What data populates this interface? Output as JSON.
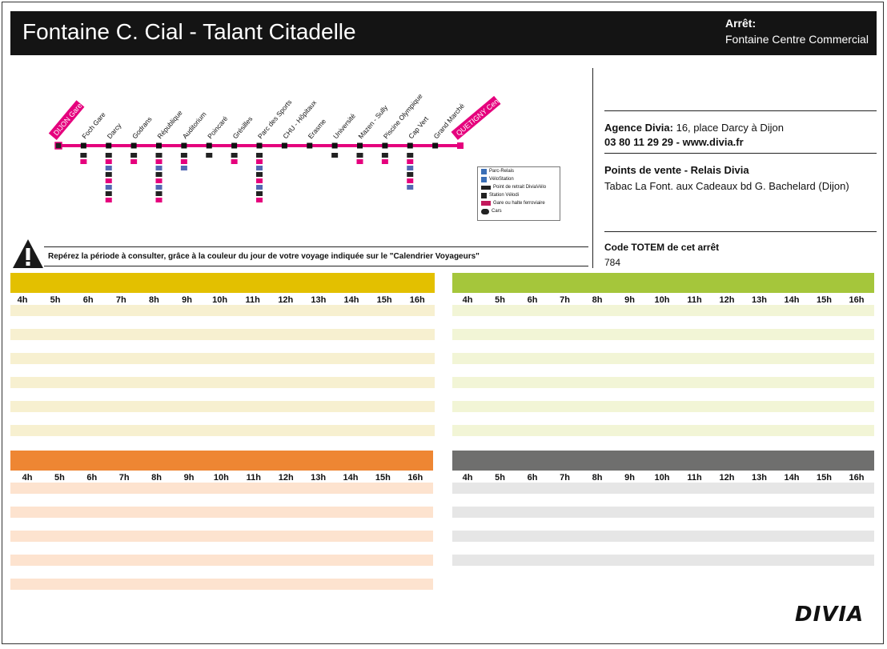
{
  "header": {
    "title": "Fontaine C. Cial - Talant Citadelle",
    "stop_label": "Arrêt:",
    "stop_name": "Fontaine Centre Commercial"
  },
  "info": {
    "agency_label": "Agence Divia:",
    "agency_address": " 16, place Darcy à Dijon",
    "agency_contact": "03 80 11 29 29 - www.divia.fr",
    "sales_title": "Points de vente - Relais Divia",
    "sales_text": "Tabac La Font. aux Cadeaux bd G. Bachelard (Dijon)",
    "totem_label": "Code TOTEM de cet arrêt",
    "totem_code": "784"
  },
  "warning": "Repérez la période à consulter, grâce à la couleur du jour de votre voyage indiquée sur le \"Calendrier Voyageurs\"",
  "route": {
    "line_color": "#e5007d",
    "start_terminal": "DIJON Gare",
    "end_terminal": "QUETIGNY Centre",
    "stops": [
      "Foch Gare",
      "Darcy",
      "Godrans",
      "République",
      "Auditorium",
      "Poincaré",
      "Grésilles",
      "Parc des Sports",
      "CHU - Hôpitaux",
      "Erasme",
      "Université",
      "Mazen - Sully",
      "Piscine Olympique",
      "Cap Vert",
      "Grand Marché"
    ]
  },
  "legend": {
    "items": [
      "Parc-Relais",
      "VéloStation",
      "Point de retrait DiviaVélo",
      "Station Vélodi",
      "Gare ou halte ferroviaire",
      "Cars"
    ]
  },
  "timetables": [
    {
      "color": "#e3c000",
      "row_color": "#f7f0d0",
      "hours": [
        "4h",
        "5h",
        "6h",
        "7h",
        "8h",
        "9h",
        "10h",
        "11h",
        "12h",
        "13h",
        "14h",
        "15h",
        "16h"
      ]
    },
    {
      "color": "#a5c63b",
      "row_color": "#f2f5d6",
      "hours": [
        "4h",
        "5h",
        "6h",
        "7h",
        "8h",
        "9h",
        "10h",
        "11h",
        "12h",
        "13h",
        "14h",
        "15h",
        "16h"
      ]
    },
    {
      "color": "#ee8633",
      "row_color": "#fde3cf",
      "hours": [
        "4h",
        "5h",
        "6h",
        "7h",
        "8h",
        "9h",
        "10h",
        "11h",
        "12h",
        "13h",
        "14h",
        "15h",
        "16h"
      ]
    },
    {
      "color": "#6f6f6e",
      "row_color": "#e6e6e6",
      "hours": [
        "4h",
        "5h",
        "6h",
        "7h",
        "8h",
        "9h",
        "10h",
        "11h",
        "12h",
        "13h",
        "14h",
        "15h",
        "16h"
      ]
    }
  ],
  "logo_text": "DIVIA"
}
